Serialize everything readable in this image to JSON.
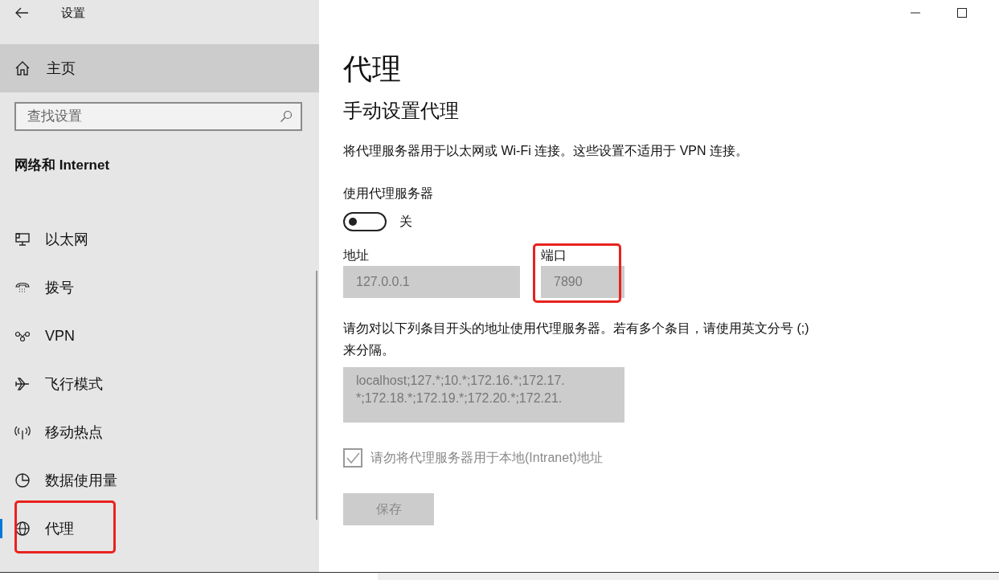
{
  "window": {
    "title": "设置"
  },
  "sidebar": {
    "home": "主页",
    "search": {
      "placeholder": "查找设置"
    },
    "section": "网络和 Internet",
    "items": [
      {
        "label": "以太网",
        "kind": "ethernet",
        "selected": false,
        "highlighted": false
      },
      {
        "label": "拨号",
        "kind": "dialup",
        "selected": false,
        "highlighted": false
      },
      {
        "label": "VPN",
        "kind": "vpn",
        "selected": false,
        "highlighted": false
      },
      {
        "label": "飞行模式",
        "kind": "airplane",
        "selected": false,
        "highlighted": false
      },
      {
        "label": "移动热点",
        "kind": "hotspot",
        "selected": false,
        "highlighted": false
      },
      {
        "label": "数据使用量",
        "kind": "data",
        "selected": false,
        "highlighted": false
      },
      {
        "label": "代理",
        "kind": "globe",
        "selected": true,
        "highlighted": true
      }
    ]
  },
  "page": {
    "title": "代理",
    "subtitle": "手动设置代理",
    "description": "将代理服务器用于以太网或 Wi-Fi 连接。这些设置不适用于 VPN 连接。",
    "use_proxy": {
      "label": "使用代理服务器",
      "on": false,
      "state_text": "关"
    },
    "address": {
      "label": "地址",
      "value": "127.0.0.1",
      "disabled": true
    },
    "port": {
      "label": "端口",
      "value": "7890",
      "disabled": true,
      "highlighted": true
    },
    "exceptions_text": "请勿对以下列条目开头的地址使用代理服务器。若有多个条目，请使用英文分号 (;) 来分隔。",
    "exceptions_lines": [
      "localhost;127.*;10.*;172.16.*;172.17.",
      "*;172.18.*;172.19.*;172.20.*;172.21."
    ],
    "bypass_local": {
      "label": "请勿将代理服务器用于本地(Intranet)地址",
      "checked": true,
      "disabled": true
    },
    "save_button": {
      "label": "保存",
      "disabled": true
    }
  }
}
